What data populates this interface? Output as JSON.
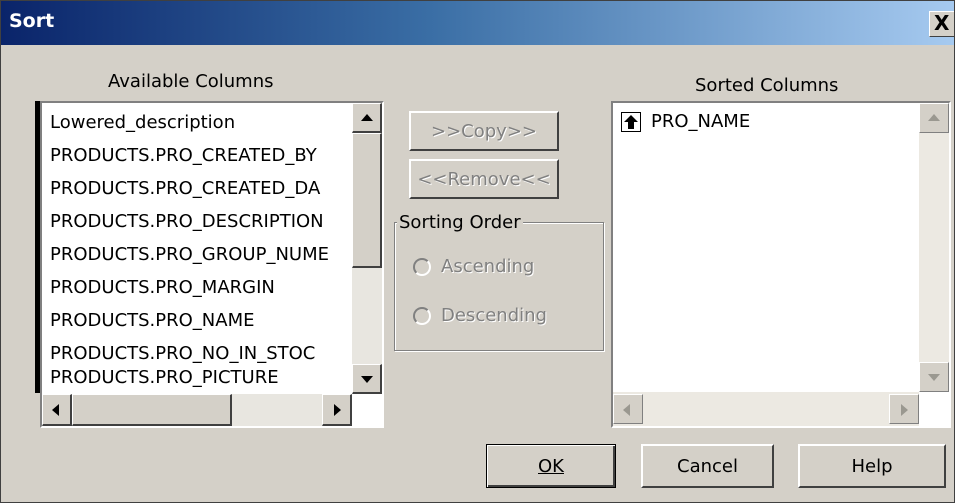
{
  "window": {
    "title": "Sort",
    "close_glyph": "X"
  },
  "available": {
    "label": "Available Columns",
    "items": [
      "Lowered_description",
      "PRODUCTS.PRO_CREATED_BY",
      "PRODUCTS.PRO_CREATED_DA",
      "PRODUCTS.PRO_DESCRIPTION",
      "PRODUCTS.PRO_GROUP_NUME",
      "PRODUCTS.PRO_MARGIN",
      "PRODUCTS.PRO_NAME",
      "PRODUCTS.PRO_NO_IN_STOC",
      "PRODUCTS.PRO_PICTURE"
    ]
  },
  "sorted": {
    "label": "Sorted Columns",
    "items": [
      {
        "name": "PRO_NAME",
        "direction_icon": "ascending-arrow-icon"
      }
    ]
  },
  "actions": {
    "copy_label": ">>Copy>>",
    "remove_label": "<<Remove<<"
  },
  "sorting_order": {
    "legend": "Sorting Order",
    "ascending_label": "Ascending",
    "descending_label": "Descending",
    "enabled": false
  },
  "footer": {
    "ok_label": "OK",
    "cancel_label": "Cancel",
    "help_label": "Help"
  },
  "colors": {
    "dialog_bg": "#d4d0c8",
    "titlebar_start": "#0a246a",
    "titlebar_end": "#a6caf0",
    "disabled_text": "#808080"
  }
}
